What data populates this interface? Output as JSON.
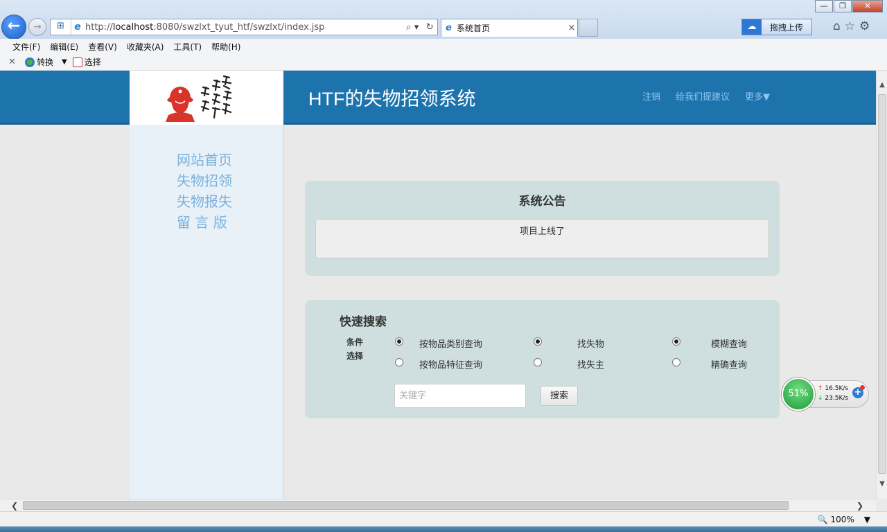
{
  "browser": {
    "window_controls": {
      "minimize": "—",
      "restore": "❐",
      "close": "✕"
    },
    "back_glyph": "←",
    "forward_glyph": "→",
    "address": {
      "url_prefix": "http://",
      "host": "localhost",
      "url_rest": ":8080/swzlxt_tyut_htf/swzlxt/index.jsp",
      "tools": [
        "⌕ ▾",
        "↻"
      ]
    },
    "tab": {
      "title": "系统首页",
      "close": "×"
    },
    "upload_button": {
      "label": "拖拽上传",
      "icon": "baidu-cloud-icon"
    },
    "chrome_icons": [
      "⌂",
      "☆",
      "⚙"
    ],
    "menu": [
      "文件(F)",
      "编辑(E)",
      "查看(V)",
      "收藏夹(A)",
      "工具(T)",
      "帮助(H)"
    ],
    "commandbar": {
      "close": "✕",
      "convert": "转换",
      "arrow": "▼",
      "select": "选择"
    }
  },
  "site": {
    "title": "HTF的失物招领系统",
    "top_nav": [
      "注销",
      "给我们提建议",
      "更多▼"
    ],
    "side_nav": [
      "网站首页",
      "失物招领",
      "失物报失",
      "留 言 版"
    ]
  },
  "notice": {
    "title": "系统公告",
    "content": "项目上线了"
  },
  "quick_search": {
    "title": "快速搜索",
    "condition_label_1": "条件",
    "condition_label_2": "选择",
    "options": [
      {
        "label": "按物品类别查询",
        "checked": true
      },
      {
        "label": "按物品特征查询",
        "checked": false
      },
      {
        "label": "找失物",
        "checked": true
      },
      {
        "label": "找失主",
        "checked": false
      },
      {
        "label": "模糊查询",
        "checked": true
      },
      {
        "label": "精确查询",
        "checked": false
      }
    ],
    "keyword_placeholder": "关键字",
    "keyword_value": "",
    "search_button": "搜索"
  },
  "net_widget": {
    "percent": "51%",
    "up": "16.5K/s",
    "down": "23.5K/s",
    "up_arrow": "↑",
    "down_arrow": "↓",
    "plus": "+"
  },
  "scroll": {
    "up": "▲",
    "down": "▼",
    "left": "❮",
    "right": "❯"
  },
  "status": {
    "zoom": "🔍 100%",
    "zoom_arrow": "▼"
  },
  "colors": {
    "header": "#1d74ad",
    "panel": "#cfdfdf",
    "sidebar": "#e8f0f8",
    "side_link": "#7ab2dc",
    "top_link": "#8ec4ee"
  }
}
